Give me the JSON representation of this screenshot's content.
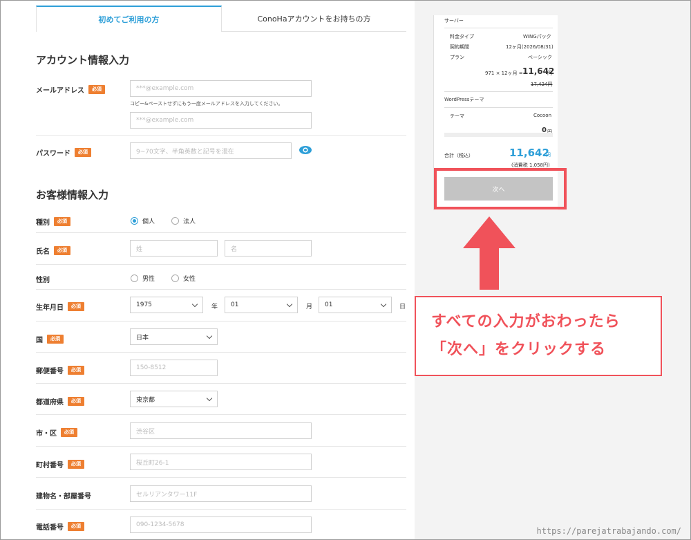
{
  "tabs": {
    "new": "初めてご利用の方",
    "existing": "ConoHaアカウントをお持ちの方"
  },
  "account": {
    "title": "アカウント情報入力",
    "email_label": "メールアドレス",
    "email_placeholder": "***@example.com",
    "email_note": "コピー&ペーストせずにもう一度メールアドレスを入力してください。",
    "email_confirm_placeholder": "***@example.com",
    "password_label": "パスワード",
    "password_placeholder": "9~70文字、半角英数と記号を混在"
  },
  "required": "必須",
  "customer": {
    "title": "お客様情報入力",
    "type_label": "種別",
    "type_options": [
      "個人",
      "法人"
    ],
    "name_label": "氏名",
    "last_name_placeholder": "姓",
    "first_name_placeholder": "名",
    "gender_label": "性別",
    "gender_options": [
      "男性",
      "女性"
    ],
    "birth_label": "生年月日",
    "birth_year": "1975",
    "birth_year_unit": "年",
    "birth_month": "01",
    "birth_month_unit": "月",
    "birth_day": "01",
    "birth_day_unit": "日",
    "country_label": "国",
    "country_value": "日本",
    "zip_label": "郵便番号",
    "zip_placeholder": "150-8512",
    "pref_label": "都道府県",
    "pref_value": "東京都",
    "city_label": "市・区",
    "city_placeholder": "渋谷区",
    "town_label": "町村番号",
    "town_placeholder": "桜丘町26-1",
    "building_label": "建物名・部屋番号",
    "building_placeholder": "セルリアンタワー11F",
    "phone_label": "電話番号",
    "phone_placeholder": "090-1234-5678"
  },
  "summary": {
    "server_heading": "サーバー",
    "plan_type_label": "料金タイプ",
    "plan_type_value": "WINGパック",
    "term_label": "契約期間",
    "term_value": "12ヶ月(2026/08/31)",
    "plan_label": "プラン",
    "plan_value": "ベーシック",
    "calc": "971 × 12ヶ月 =",
    "price": "11,642",
    "yen": "円",
    "old_price": "17,424円",
    "wp_heading": "WordPressテーマ",
    "theme_label": "テーマ",
    "theme_value": "Cocoon",
    "theme_price": "0",
    "total_label": "合計（税込）",
    "total_value": "11,642",
    "tax_note": "(消費税 1,058円)",
    "next_button": "次へ"
  },
  "callout": {
    "line1": "すべての入力がおわったら",
    "line2": "「次へ」をクリックする"
  },
  "watermark": "https://parejatrabajando.com/",
  "colors": {
    "accent": "#2e9fd8",
    "required": "#ee7f31",
    "annotation": "#f0525a"
  }
}
